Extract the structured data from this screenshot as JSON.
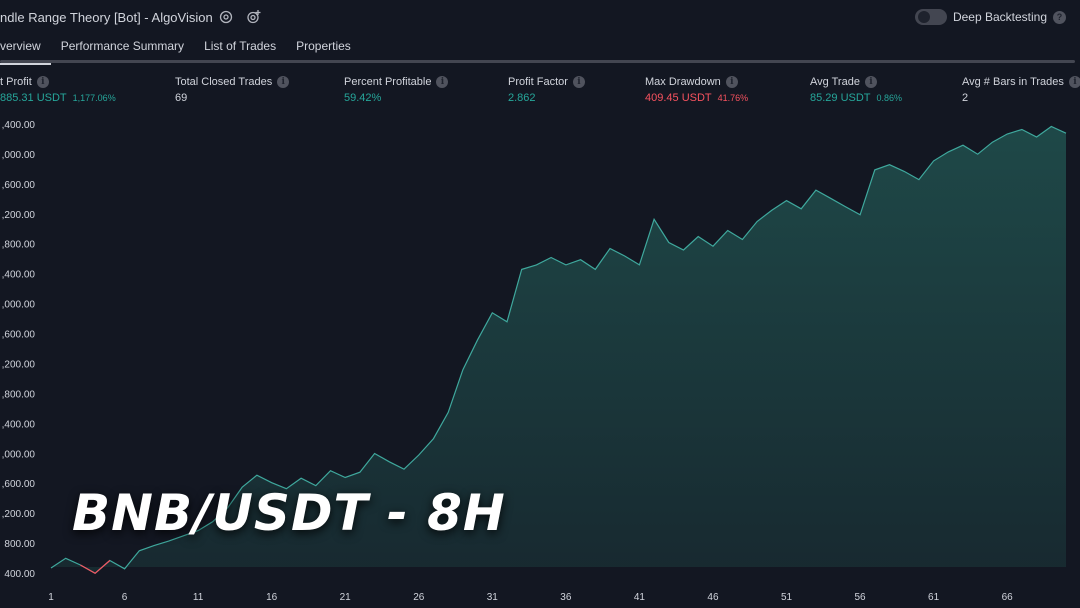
{
  "header": {
    "title": "ndle Range Theory [Bot] - AlgoVision",
    "deep_backtesting_label": "Deep Backtesting",
    "help_glyph": "?"
  },
  "tabs": [
    {
      "label": "verview",
      "active": true
    },
    {
      "label": "Performance Summary",
      "active": false
    },
    {
      "label": "List of Trades",
      "active": false
    },
    {
      "label": "Properties",
      "active": false
    }
  ],
  "info_glyph": "i",
  "metrics": {
    "net_profit": {
      "label": "t Profit",
      "value": "885.31 USDT",
      "sub": "1,177.06%"
    },
    "total_closed_trades": {
      "label": "Total Closed Trades",
      "value": "69"
    },
    "percent_profitable": {
      "label": "Percent Profitable",
      "value": "59.42%"
    },
    "profit_factor": {
      "label": "Profit Factor",
      "value": "2.862"
    },
    "max_drawdown": {
      "label": "Max Drawdown",
      "value": "409.45 USDT",
      "sub": "41.76%"
    },
    "avg_trade": {
      "label": "Avg Trade",
      "value": "85.29 USDT",
      "sub": "0.86%"
    },
    "avg_bars": {
      "label": "Avg # Bars in Trades",
      "value": "2"
    }
  },
  "overlay_title": "BNB/USDT - 8H",
  "colors": {
    "line": "#3fa89d",
    "fill": "#1f4b4a",
    "drawdown": "#f7525f",
    "background": "#131722"
  },
  "chart_data": {
    "type": "area",
    "y_tick_labels": [
      ",400.00",
      ",000.00",
      ",600.00",
      ",200.00",
      ",800.00",
      ",400.00",
      ",000.00",
      ",600.00",
      ",200.00",
      ",800.00",
      ",400.00",
      ",000.00",
      ",600.00",
      ",200.00",
      "800.00",
      "400.00"
    ],
    "y_tick_values": [
      6400,
      6000,
      5600,
      5200,
      4800,
      4400,
      4000,
      3600,
      3200,
      2800,
      2400,
      2000,
      1600,
      1200,
      800,
      400
    ],
    "x_tick_labels": [
      "1",
      "6",
      "11",
      "16",
      "21",
      "26",
      "31",
      "36",
      "41",
      "46",
      "51",
      "56",
      "61",
      "66"
    ],
    "x_tick_values": [
      1,
      6,
      11,
      16,
      21,
      26,
      31,
      36,
      41,
      46,
      51,
      56,
      61,
      66
    ],
    "xlim": [
      1,
      70
    ],
    "ylim": [
      400,
      6400
    ],
    "x": [
      1,
      2,
      3,
      4,
      5,
      6,
      7,
      8,
      9,
      10,
      11,
      12,
      13,
      14,
      15,
      16,
      17,
      18,
      19,
      20,
      21,
      22,
      23,
      24,
      25,
      26,
      27,
      28,
      29,
      30,
      31,
      32,
      33,
      34,
      35,
      36,
      37,
      38,
      39,
      40,
      41,
      42,
      43,
      44,
      45,
      46,
      47,
      48,
      49,
      50,
      51,
      52,
      53,
      54,
      55,
      56,
      57,
      58,
      59,
      60,
      61,
      62,
      63,
      64,
      65,
      66,
      67,
      68,
      69,
      70
    ],
    "y": [
      480,
      610,
      520,
      410,
      580,
      470,
      710,
      780,
      840,
      910,
      980,
      1100,
      1280,
      1560,
      1720,
      1620,
      1540,
      1680,
      1580,
      1780,
      1690,
      1760,
      2010,
      1900,
      1800,
      1990,
      2210,
      2560,
      3130,
      3530,
      3890,
      3770,
      4470,
      4530,
      4630,
      4530,
      4600,
      4470,
      4750,
      4650,
      4530,
      5140,
      4830,
      4730,
      4910,
      4780,
      4990,
      4870,
      5110,
      5260,
      5390,
      5280,
      5530,
      5420,
      5310,
      5200,
      5800,
      5870,
      5780,
      5670,
      5920,
      6040,
      6130,
      6010,
      6170,
      6280,
      6340,
      6240,
      6380,
      6290
    ],
    "drawdown_segment_x": [
      3,
      4,
      5
    ]
  }
}
